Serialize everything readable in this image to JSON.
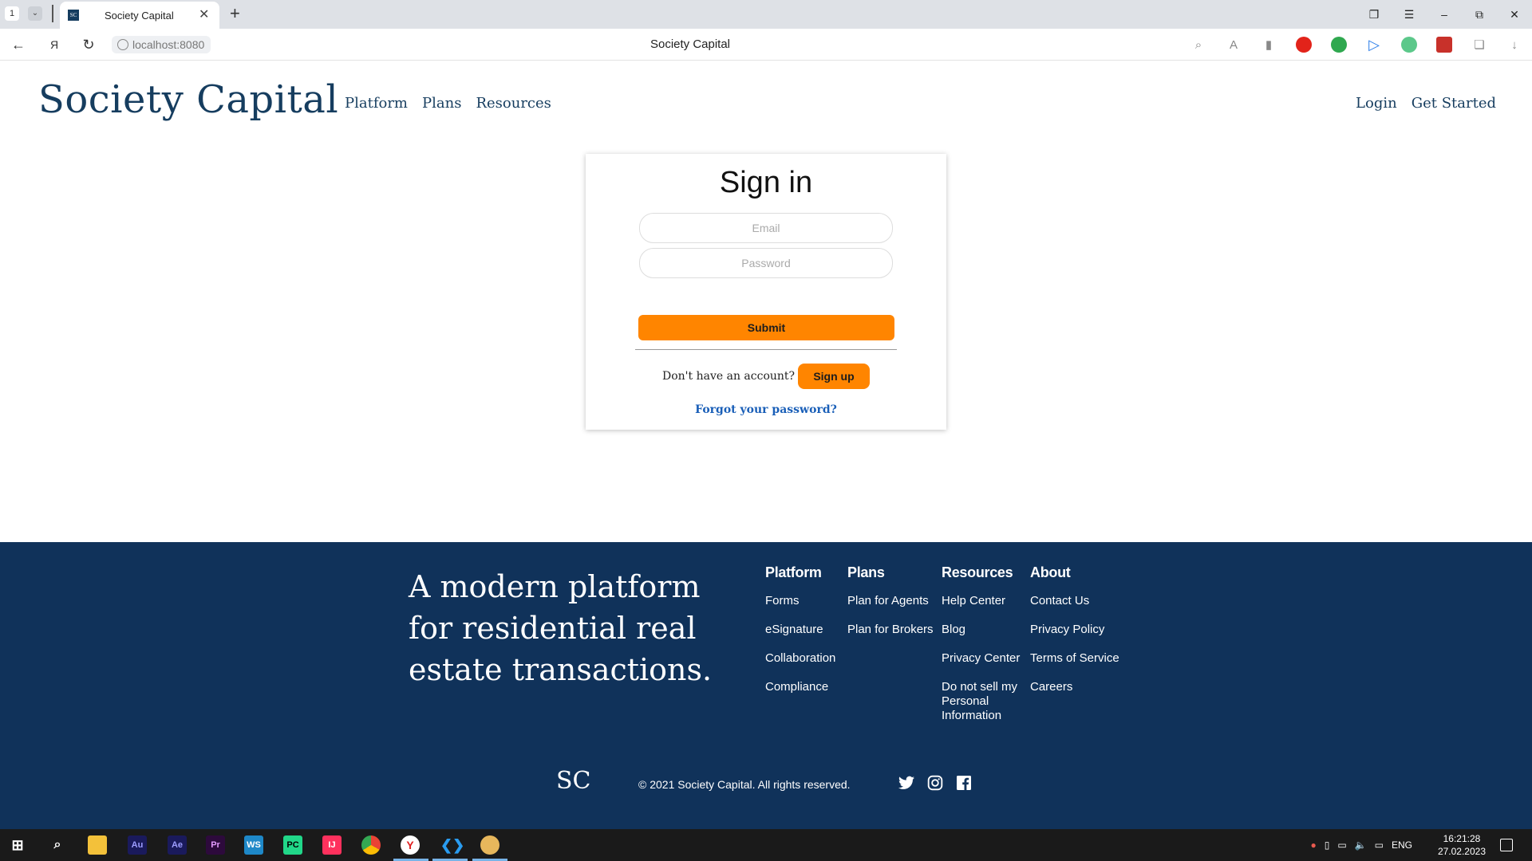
{
  "browser": {
    "tab_counter": "1",
    "tab_title": "Society Capital",
    "favicon_text": "SC",
    "url": "localhost:8080",
    "page_title": "Society Capital"
  },
  "header": {
    "logo": "Society Capital",
    "nav": [
      "Platform",
      "Plans",
      "Resources"
    ],
    "login": "Login",
    "get_started": "Get Started"
  },
  "signin": {
    "title": "Sign in",
    "email_placeholder": "Email",
    "password_placeholder": "Password",
    "submit_label": "Submit",
    "no_account_text": "Don't have an account?",
    "signup_label": "Sign up",
    "forgot_label": "Forgot your password?"
  },
  "footer": {
    "tagline": "A modern platform for residential real estate transactions.",
    "columns": [
      {
        "heading": "Platform",
        "links": [
          "Forms",
          "eSignature",
          "Collaboration",
          "Compliance"
        ]
      },
      {
        "heading": "Plans",
        "links": [
          "Plan for Agents",
          "Plan for Brokers"
        ]
      },
      {
        "heading": "Resources",
        "links": [
          "Help Center",
          "Blog",
          "Privacy Center",
          "Do not sell my Personal Information"
        ]
      },
      {
        "heading": "About",
        "links": [
          "Contact Us",
          "Privacy Policy",
          "Terms of Service",
          "Careers"
        ]
      }
    ],
    "logo": "SC",
    "copyright": "© 2021 Society Capital. All rights reserved.",
    "social": [
      "twitter-icon",
      "instagram-icon",
      "facebook-icon"
    ]
  },
  "taskbar": {
    "apps": [
      "Au",
      "Ae",
      "Pr",
      "WS",
      "PC",
      "IJ"
    ],
    "language": "ENG",
    "time": "16:21:28",
    "date": "27.02.2023"
  },
  "colors": {
    "brand_navy": "#10325a",
    "accent_orange": "#ff8500",
    "link_blue": "#1a5fb8"
  }
}
